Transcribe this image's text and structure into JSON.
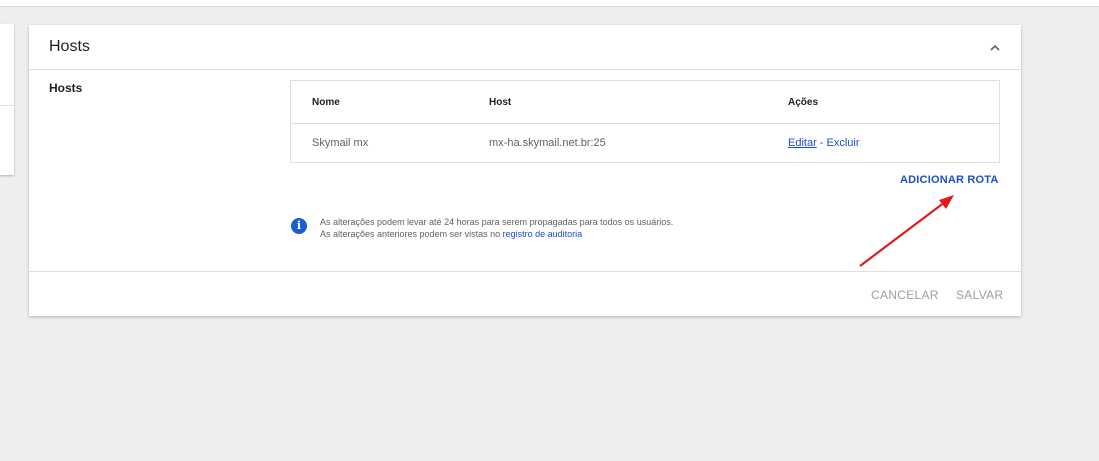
{
  "card": {
    "title": "Hosts",
    "section_label": "Hosts"
  },
  "table": {
    "headers": [
      "Nome",
      "Host",
      "Ações"
    ],
    "rows": [
      {
        "name": "Skymail mx",
        "host": "mx-ha.skymail.net.br:25",
        "edit_label": "Editar",
        "separator": " - ",
        "delete_label": "Excluir"
      }
    ]
  },
  "actions": {
    "add_route_label": "ADICIONAR ROTA"
  },
  "info": {
    "icon": "info-icon",
    "line1": "As alterações podem levar até 24 horas para serem propagadas para todos os usuários.",
    "line2_prefix": "As alterações anteriores podem ser vistas no ",
    "audit_link": "registro de auditoria"
  },
  "footer": {
    "cancel_label": "CANCELAR",
    "save_label": "SALVAR"
  },
  "colors": {
    "accent": "#1a4fc9",
    "annotation_arrow": "#e5191c",
    "background": "#eeeeee"
  }
}
